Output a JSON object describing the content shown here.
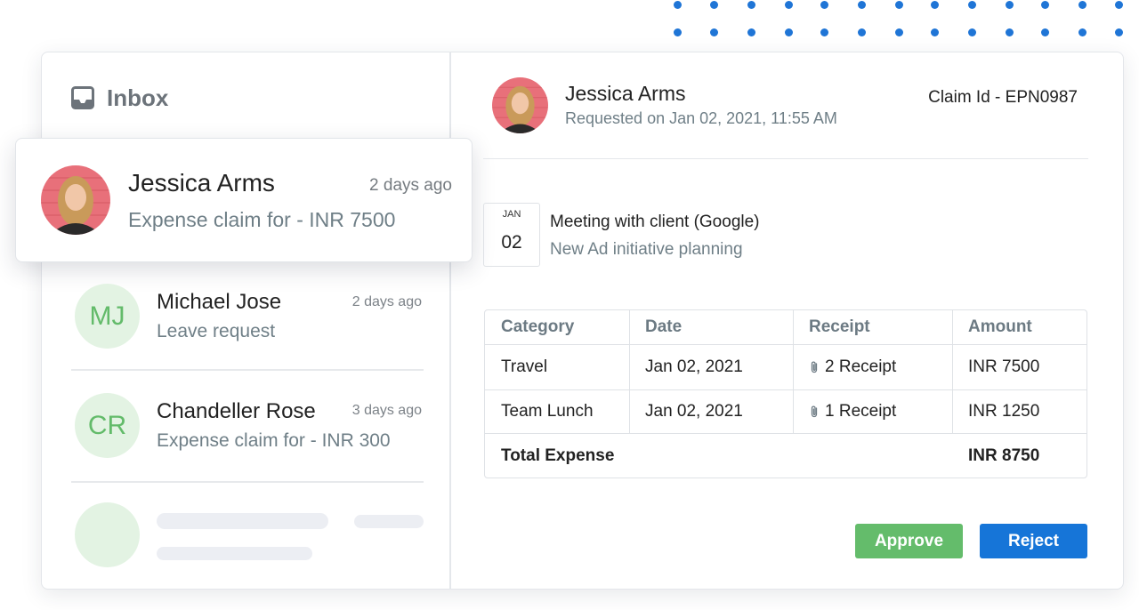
{
  "inbox": {
    "title": "Inbox",
    "icon": "inbox-tray-icon",
    "active_message": {
      "name": "Jessica Arms",
      "time": "2 days ago",
      "subject": "Expense claim for - INR 7500"
    },
    "messages": [
      {
        "initials": "MJ",
        "name": "Michael Jose",
        "time": "2 days ago",
        "subject": "Leave request"
      },
      {
        "initials": "CR",
        "name": "Chandeller Rose",
        "time": "3 days ago",
        "subject": "Expense claim for - INR 300"
      }
    ]
  },
  "detail": {
    "requester": "Jessica Arms",
    "requested_on": "Requested on Jan 02, 2021, 11:55 AM",
    "claim_id": "Claim Id - EPN0987",
    "event": {
      "month": "JAN",
      "day": "02",
      "title": "Meeting with client (Google)",
      "subtitle": "New Ad initiative planning"
    },
    "table": {
      "headers": [
        "Category",
        "Date",
        "Receipt",
        "Amount"
      ],
      "rows": [
        {
          "category": "Travel",
          "date": "Jan 02, 2021",
          "receipt": "2 Receipt",
          "amount": "INR 7500"
        },
        {
          "category": "Team Lunch",
          "date": "Jan 02, 2021",
          "receipt": "1 Receipt",
          "amount": "INR 1250"
        }
      ],
      "total_label": "Total Expense",
      "total_amount": "INR 8750"
    },
    "actions": {
      "approve": "Approve",
      "reject": "Reject"
    }
  },
  "colors": {
    "accent_blue": "#1675d8",
    "approve_green": "#64bc6b",
    "initials_bg": "#e3f3e3",
    "initials_text": "#63bb6a"
  }
}
